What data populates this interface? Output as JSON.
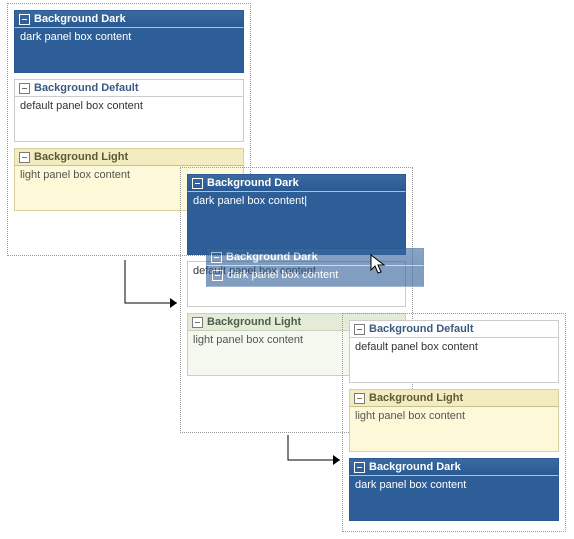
{
  "panel_titles": {
    "dark": "Background Dark",
    "default": "Background Default",
    "light": "Background Light"
  },
  "panel_contents": {
    "dark": "dark panel box content",
    "dark_editing": "dark panel box content|",
    "default": "default panel box content",
    "light": "light panel box content"
  },
  "frame1": {
    "panels": [
      {
        "kind": "dark",
        "title_key": "dark",
        "body_key": "dark"
      },
      {
        "kind": "default",
        "title_key": "default",
        "body_key": "default"
      },
      {
        "kind": "light",
        "title_key": "light",
        "body_key": "light"
      }
    ]
  },
  "frame2": {
    "panels": [
      {
        "kind": "dark",
        "title_key": "dark",
        "body_key": "dark_editing"
      },
      {
        "kind": "default",
        "title_key": "default",
        "body_key": "default"
      },
      {
        "kind": "light2",
        "title_key": "light",
        "body_key": "light"
      }
    ]
  },
  "frame3": {
    "panels": [
      {
        "kind": "default",
        "title_key": "default",
        "body_key": "default"
      },
      {
        "kind": "light",
        "title_key": "light",
        "body_key": "light"
      },
      {
        "kind": "dark",
        "title_key": "dark",
        "body_key": "dark"
      }
    ]
  },
  "drag_ghost": {
    "title_key": "dark",
    "body_key": "dark"
  }
}
